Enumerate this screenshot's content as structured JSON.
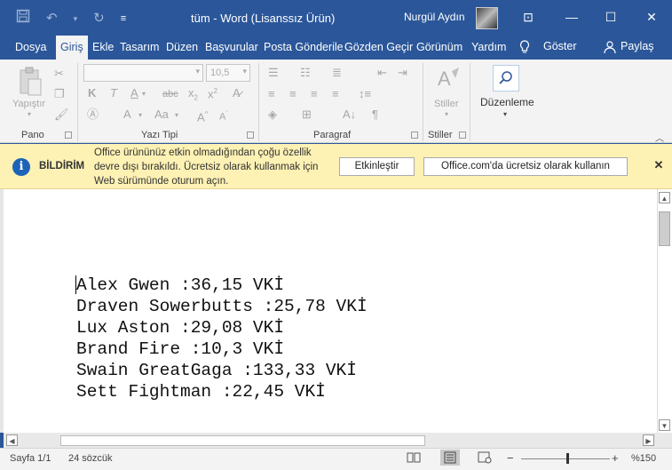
{
  "colors": {
    "brand": "#2b579a",
    "notify_bg": "#fdf1b4",
    "info": "#1d63b7"
  },
  "titlebar": {
    "title": "tüm  -  Word (Lisanssız Ürün)",
    "user": "Nurgül Aydın",
    "qat": {
      "save_icon": "save-icon",
      "undo_icon": "undo-icon",
      "redo_icon": "redo-icon",
      "customize_icon": "customize-qat-icon"
    },
    "minimize": "—",
    "maximize": "☐",
    "close": "✕",
    "ribbon_display": "⊡"
  },
  "tabs": {
    "items": [
      "Dosya",
      "Giriş",
      "Ekle",
      "Tasarım",
      "Düzen",
      "Başvurular",
      "Posta Gönderile",
      "Gözden Geçir",
      "Görünüm",
      "Yardım"
    ],
    "active": "Giriş",
    "tell_me": "Göster",
    "share": "Paylaş"
  },
  "ribbon": {
    "clipboard": {
      "label": "Pano",
      "paste": "Yapıştır"
    },
    "font": {
      "label": "Yazı Tipi",
      "font_name": "",
      "font_size": "10,5"
    },
    "paragraph": {
      "label": "Paragraf"
    },
    "styles": {
      "label": "Stiller",
      "styles_button": "Stiller"
    },
    "editing": {
      "label": "Düzenleme"
    }
  },
  "notification": {
    "title": "BİLDİRİM",
    "message": "Office ürününüz etkin olmadığından çoğu özellik devre dışı bırakıldı. Ücretsiz olarak kullanmak için Web sürümünde oturum açın.",
    "activate_button": "Etkinleştir",
    "web_button": "Office.com'da ücretsiz olarak kullanın"
  },
  "document": {
    "lines": [
      "Alex Gwen :36,15 VKİ",
      "Draven Sowerbutts :25,78 VKİ",
      "Lux Aston :29,08 VKİ",
      "Brand Fire :10,3 VKİ",
      "Swain GreatGaga :133,33 VKİ",
      "Sett Fightman :22,45 VKİ"
    ]
  },
  "status": {
    "page": "Sayfa 1/1",
    "words": "24 sözcük",
    "zoom": "%150"
  }
}
